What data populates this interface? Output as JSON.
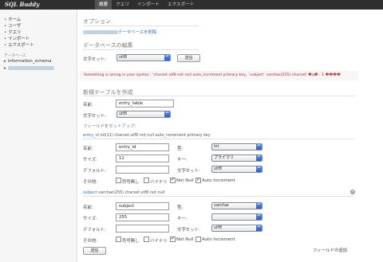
{
  "app": {
    "logo": "SQL Buddy"
  },
  "nav": [
    "概要",
    "クエリ",
    "インポート",
    "エクスポート"
  ],
  "sidebar": {
    "items": [
      "ホーム",
      "ユーザ",
      "クエリ",
      "インポート",
      "エクスポート"
    ],
    "db_header": "データベース",
    "databases": [
      "information_schema"
    ]
  },
  "options": {
    "title": "オプション",
    "drop_link": "データベースを削除"
  },
  "edit_db": {
    "title": "データベースの編集",
    "charset_label": "文字セット:",
    "charset_value": "utf8",
    "submit": "送信"
  },
  "error": {
    "message": "Something is wrong in your syntax : 'charset utf8 not null auto_increment primary key, `subject` varchar(255) charset' �ɋ� : 1 ����"
  },
  "new_table": {
    "title": "新規テーブルを作成",
    "name_label": "名前:",
    "name_value": "entry_table",
    "charset_label": "文字セット:",
    "charset_value": "utf8",
    "set_fields": "フィールドをセットアップ:"
  },
  "fields": [
    {
      "header_name": "entry_id",
      "header_rest": "int(11) charset utf8 not null auto_increment primary key",
      "name_label": "名前:",
      "name_value": "entry_id",
      "type_label": "型:",
      "type_value": "int",
      "size_label": "サイズ:",
      "size_value": "11",
      "key_label": "キー:",
      "key_value": "プライマリ",
      "default_label": "デフォルト:",
      "default_value": "",
      "charset_label": "文字セット:",
      "charset_value": "utf8",
      "other_label": "その他:",
      "unsigned": "符号無し",
      "binary": "バイナリ",
      "not_null": "Not Null",
      "auto_increment": "Auto Increment",
      "unsigned_checked": false,
      "binary_checked": false,
      "not_null_checked": true,
      "auto_increment_checked": true
    },
    {
      "header_name": "subject",
      "header_rest": "varchar(255) charset utf8 not null",
      "name_label": "名前:",
      "name_value": "subject",
      "type_label": "型:",
      "type_value": "varchar",
      "size_label": "サイズ:",
      "size_value": "255",
      "key_label": "キー:",
      "key_value": "",
      "default_label": "デフォルト:",
      "default_value": "",
      "charset_label": "文字セット:",
      "charset_value": "utf8",
      "other_label": "その他:",
      "unsigned": "符号無し",
      "binary": "バイナリ",
      "not_null": "Not Null",
      "auto_increment": "Auto Increment",
      "unsigned_checked": false,
      "binary_checked": false,
      "not_null_checked": true,
      "auto_increment_checked": false
    }
  ],
  "add_field": "フィールドの追加",
  "submit": "送信",
  "colors": {
    "link": "#3b6fb5",
    "error": "#b02020",
    "topbar": "#2f2f2f"
  }
}
